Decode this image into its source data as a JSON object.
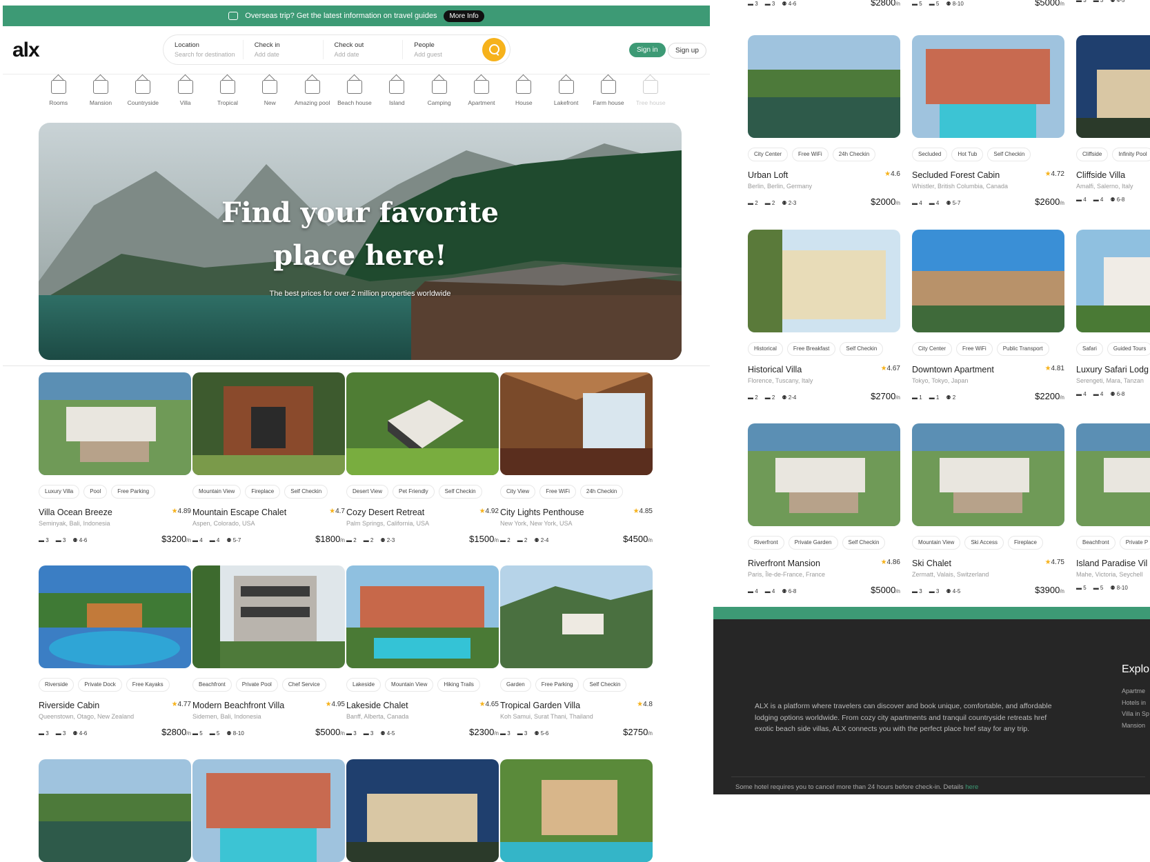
{
  "banner": {
    "text": "Overseas trip? Get the latest information on travel guides",
    "more_label": "More Info"
  },
  "brand": {
    "logo": "alx",
    "accent": "#3d9a75",
    "search_accent": "#f6b21b"
  },
  "search": {
    "fields": [
      {
        "label": "Location",
        "placeholder": "Search for destination"
      },
      {
        "label": "Check in",
        "placeholder": "Add date"
      },
      {
        "label": "Check out",
        "placeholder": "Add date"
      },
      {
        "label": "People",
        "placeholder": "Add guest"
      }
    ],
    "button_icon": "search-icon"
  },
  "auth": {
    "signin": "Sign in",
    "signup": "Sign up"
  },
  "categories": [
    "Rooms",
    "Mansion",
    "Countryside",
    "Villa",
    "Tropical",
    "New",
    "Amazing pool",
    "Beach house",
    "Island",
    "Camping",
    "Apartment",
    "House",
    "Lakefront",
    "Farm house",
    "Tree house"
  ],
  "hero": {
    "title_line1": "Find your favorite",
    "title_line2": "place here!",
    "subtitle": "The best prices for over 2 million properties worldwide"
  },
  "listings": [
    {
      "tags": [
        "Luxury Villa",
        "Pool",
        "Free Parking"
      ],
      "name": "Villa Ocean Breeze",
      "rating": "4.89",
      "location": "Seminyak, Bali, Indonesia",
      "beds": "3",
      "baths": "3",
      "guests": "4-6",
      "price": "$3200",
      "per": "/n"
    },
    {
      "tags": [
        "Mountain View",
        "Fireplace",
        "Self Checkin"
      ],
      "name": "Mountain Escape Chalet",
      "rating": "4.7",
      "location": "Aspen, Colorado, USA",
      "beds": "4",
      "baths": "4",
      "guests": "5-7",
      "price": "$1800",
      "per": "/n"
    },
    {
      "tags": [
        "Desert View",
        "Pet Friendly",
        "Self Checkin"
      ],
      "name": "Cozy Desert Retreat",
      "rating": "4.92",
      "location": "Palm Springs, California, USA",
      "beds": "2",
      "baths": "2",
      "guests": "2-3",
      "price": "$1500",
      "per": "/n"
    },
    {
      "tags": [
        "City View",
        "Free WiFi",
        "24h Checkin"
      ],
      "name": "City Lights Penthouse",
      "rating": "4.85",
      "location": "New York, New York, USA",
      "beds": "2",
      "baths": "2",
      "guests": "2-4",
      "price": "$4500",
      "per": "/n"
    },
    {
      "tags": [
        "Riverside",
        "Private Dock",
        "Free Kayaks"
      ],
      "name": "Riverside Cabin",
      "rating": "4.77",
      "location": "Queenstown, Otago, New Zealand",
      "beds": "3",
      "baths": "3",
      "guests": "4-6",
      "price": "$2800",
      "per": "/n"
    },
    {
      "tags": [
        "Beachfront",
        "Private Pool",
        "Chef Service"
      ],
      "name": "Modern Beachfront Villa",
      "rating": "4.95",
      "location": "Sidemen, Bali, Indonesia",
      "beds": "5",
      "baths": "5",
      "guests": "8-10",
      "price": "$5000",
      "per": "/n"
    },
    {
      "tags": [
        "Lakeside",
        "Mountain View",
        "Hiking Trails"
      ],
      "name": "Lakeside Chalet",
      "rating": "4.65",
      "location": "Banff, Alberta, Canada",
      "beds": "3",
      "baths": "3",
      "guests": "4-5",
      "price": "$2300",
      "per": "/n"
    },
    {
      "tags": [
        "Garden",
        "Free Parking",
        "Self Checkin"
      ],
      "name": "Tropical Garden Villa",
      "rating": "4.8",
      "location": "Koh Samui, Surat Thani, Thailand",
      "beds": "3",
      "baths": "3",
      "guests": "5-6",
      "price": "$2750",
      "per": "/n"
    }
  ],
  "right_top_strip": [
    {
      "beds": "3",
      "baths": "3",
      "guests": "4-6",
      "price": "$2800",
      "per": "/n"
    },
    {
      "beds": "5",
      "baths": "5",
      "guests": "8-10",
      "price": "$5000",
      "per": "/n"
    },
    {
      "beds": "3",
      "baths": "3",
      "guests": "4-5"
    }
  ],
  "right_listings": [
    {
      "tags": [
        "City Center",
        "Free WiFi",
        "24h Checkin"
      ],
      "name": "Urban Loft",
      "rating": "4.6",
      "location": "Berlin, Berlin, Germany",
      "beds": "2",
      "baths": "2",
      "guests": "2-3",
      "price": "$2000",
      "per": "/n"
    },
    {
      "tags": [
        "Secluded",
        "Hot Tub",
        "Self Checkin"
      ],
      "name": "Secluded Forest Cabin",
      "rating": "4.72",
      "location": "Whistler, British Columbia, Canada",
      "beds": "4",
      "baths": "4",
      "guests": "5-7",
      "price": "$2600",
      "per": "/n"
    },
    {
      "tags": [
        "Cliffside",
        "Infinity Pool"
      ],
      "name": "Cliffside Villa",
      "rating": "",
      "location": "Amalfi, Salerno, Italy",
      "beds": "4",
      "baths": "4",
      "guests": "6-8",
      "price": "",
      "per": ""
    },
    {
      "tags": [
        "Historical",
        "Free Breakfast",
        "Self Checkin"
      ],
      "name": "Historical Villa",
      "rating": "4.67",
      "location": "Florence, Tuscany, Italy",
      "beds": "2",
      "baths": "2",
      "guests": "2-4",
      "price": "$2700",
      "per": "/n"
    },
    {
      "tags": [
        "City Center",
        "Free WiFi",
        "Public Transport"
      ],
      "name": "Downtown Apartment",
      "rating": "4.81",
      "location": "Tokyo, Tokyo, Japan",
      "beds": "1",
      "baths": "1",
      "guests": "2",
      "price": "$2200",
      "per": "/n"
    },
    {
      "tags": [
        "Safari",
        "Guided Tours"
      ],
      "name": "Luxury Safari Lodg",
      "rating": "",
      "location": "Serengeti, Mara, Tanzan",
      "beds": "4",
      "baths": "4",
      "guests": "6-8",
      "price": "",
      "per": ""
    },
    {
      "tags": [
        "Riverfront",
        "Private Garden",
        "Self Checkin"
      ],
      "name": "Riverfront Mansion",
      "rating": "4.86",
      "location": "Paris, Île-de-France, France",
      "beds": "4",
      "baths": "4",
      "guests": "6-8",
      "price": "$5000",
      "per": "/n"
    },
    {
      "tags": [
        "Mountain View",
        "Ski Access",
        "Fireplace"
      ],
      "name": "Ski Chalet",
      "rating": "4.75",
      "location": "Zermatt, Valais, Switzerland",
      "beds": "3",
      "baths": "3",
      "guests": "4-5",
      "price": "$3900",
      "per": "/n"
    },
    {
      "tags": [
        "Beachfront",
        "Private P"
      ],
      "name": "Island Paradise Vil",
      "rating": "",
      "location": "Mahe, Victoria, Seychell",
      "beds": "5",
      "baths": "5",
      "guests": "8-10",
      "price": "",
      "per": ""
    }
  ],
  "footer": {
    "about": "ALX is a platform where travelers can discover and book unique, comfortable, and affordable lodging options worldwide. From cozy city apartments and tranquil countryside retreats href exotic beach side villas, ALX connects you with the perfect place href stay for any trip.",
    "explore_title": "Explo",
    "explore_links": [
      "Apartme",
      "Hotels in",
      "Villa in Sp",
      "Mansion"
    ],
    "legal": "Some hotel requires you to cancel more than 24 hours before check-in. Details",
    "legal_link": "here"
  }
}
